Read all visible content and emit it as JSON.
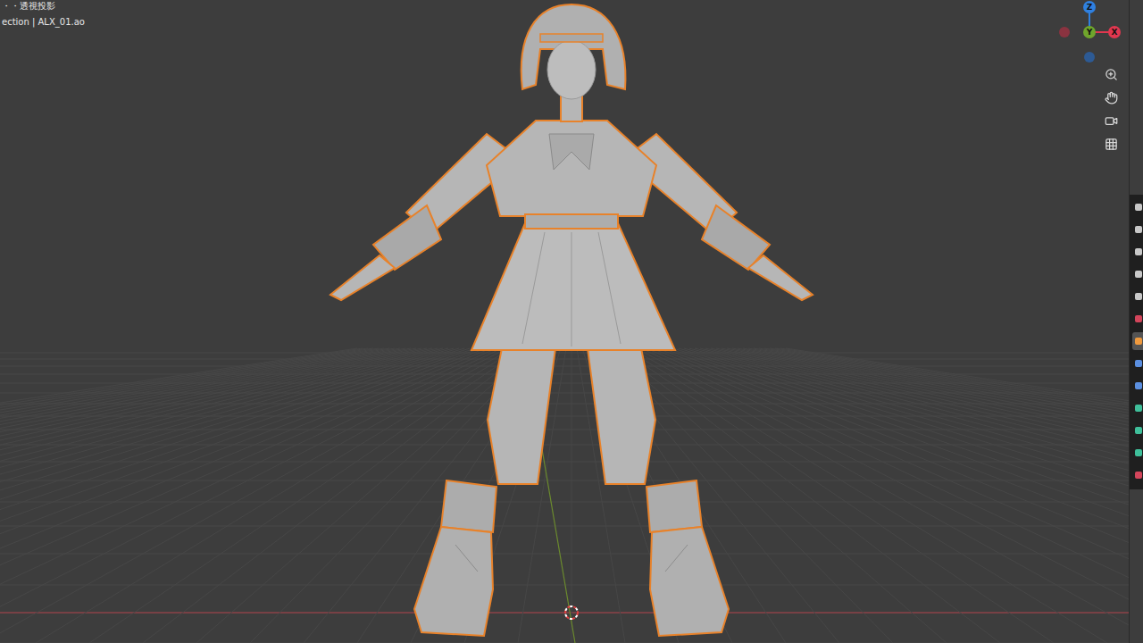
{
  "viewport": {
    "mode_label": "・・透視投影",
    "collection_label": "ection | ALX_01.ao"
  },
  "model": {
    "selected": true
  },
  "gizmo": {
    "axes": [
      {
        "label": "Z",
        "color": "#2f80e0"
      },
      {
        "label": "Y",
        "color": "#6fa52c"
      },
      {
        "label": "X",
        "color": "#e0374f"
      }
    ]
  },
  "properties_tabs": [
    {
      "kind": "tool",
      "selected": false
    },
    {
      "kind": "render",
      "selected": false
    },
    {
      "kind": "output",
      "selected": false
    },
    {
      "kind": "view",
      "selected": false
    },
    {
      "kind": "scene",
      "selected": false
    },
    {
      "kind": "world",
      "selected": false
    },
    {
      "kind": "object",
      "selected": true
    },
    {
      "kind": "modifier",
      "selected": false
    },
    {
      "kind": "particles",
      "selected": false
    },
    {
      "kind": "physics",
      "selected": false
    },
    {
      "kind": "constraints",
      "selected": false
    },
    {
      "kind": "data",
      "selected": false
    },
    {
      "kind": "texture",
      "selected": false
    }
  ]
}
